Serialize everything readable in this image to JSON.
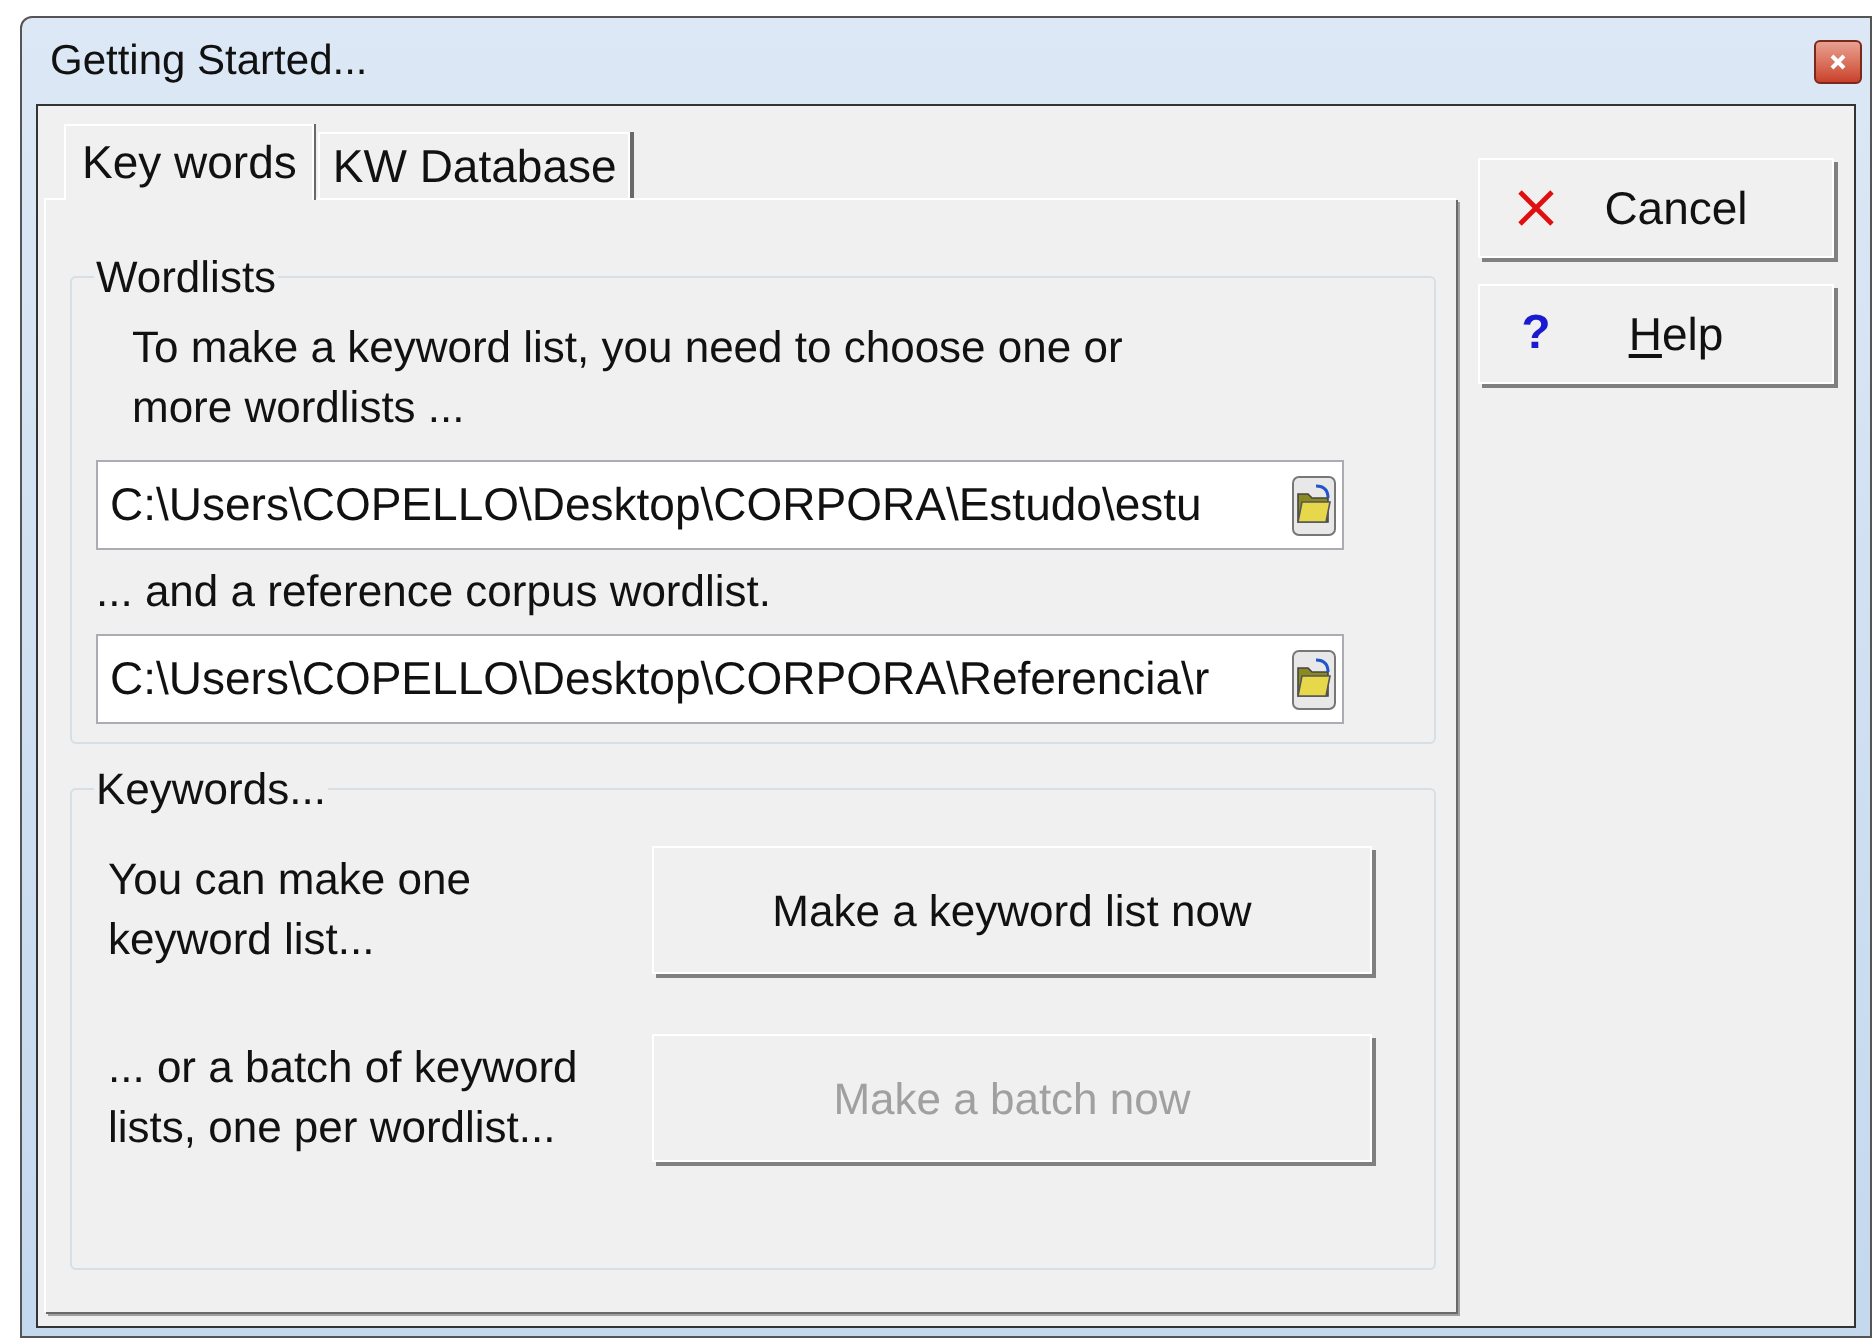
{
  "window": {
    "title": "Getting Started..."
  },
  "tabs": [
    {
      "label": "Key words",
      "selected": true
    },
    {
      "label": "KW Database",
      "selected": false
    }
  ],
  "wordlists": {
    "legend": "Wordlists",
    "intro": "To make a keyword list, you need to choose one or more wordlists ...",
    "study_path": "C:\\Users\\COPELLO\\Desktop\\CORPORA\\Estudo\\estu",
    "reference_label": "... and a reference corpus wordlist.",
    "reference_path": "C:\\Users\\COPELLO\\Desktop\\CORPORA\\Referencia\\r"
  },
  "keywords": {
    "legend": "Keywords...",
    "rows": [
      {
        "text": "You can make one keyword list...",
        "button": "Make a keyword list now",
        "disabled": false
      },
      {
        "text": "... or a batch of keyword lists, one per wordlist...",
        "button": "Make a batch now",
        "disabled": true
      }
    ]
  },
  "side_buttons": [
    {
      "kind": "cancel",
      "label": "Cancel",
      "underline_first": false
    },
    {
      "kind": "help",
      "label": "Help",
      "underline_first": true,
      "icon_text": "?"
    }
  ]
}
